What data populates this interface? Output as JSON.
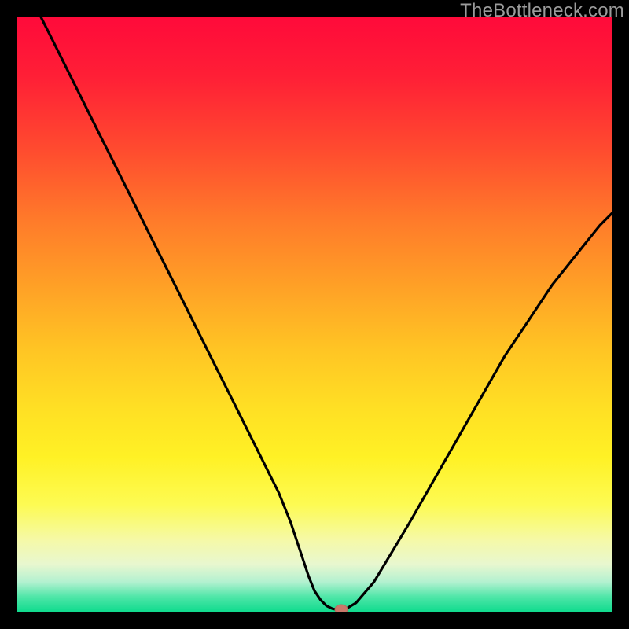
{
  "watermark": "TheBottleneck.com",
  "colors": {
    "frame": "#000000",
    "curve": "#000000",
    "marker_fill": "#c9786a",
    "marker_stroke": "#b86c5f",
    "gradient_top": "#ff0a3a",
    "gradient_bottom": "#10db8e"
  },
  "chart_data": {
    "type": "line",
    "title": "",
    "xlabel": "",
    "ylabel": "",
    "xlim": [
      0,
      100
    ],
    "ylim": [
      0,
      100
    ],
    "series": [
      {
        "name": "bottleneck-curve",
        "x": [
          4,
          6,
          8,
          10,
          12,
          14,
          16,
          18,
          20,
          22,
          24,
          26,
          28,
          30,
          32,
          34,
          36,
          38,
          40,
          42,
          44,
          46,
          47,
          48,
          49,
          50,
          51,
          52,
          53,
          54,
          55,
          57,
          60,
          63,
          66,
          70,
          74,
          78,
          82,
          86,
          90,
          94,
          98,
          100
        ],
        "y": [
          100,
          96,
          92,
          88,
          84,
          80,
          76,
          72,
          68,
          64,
          60,
          56,
          52,
          48,
          44,
          40,
          36,
          32,
          28,
          24,
          20,
          15,
          12,
          9,
          6,
          3.5,
          2,
          1,
          0.5,
          0.3,
          0.3,
          1.5,
          5,
          10,
          15,
          22,
          29,
          36,
          43,
          49,
          55,
          60,
          65,
          67
        ]
      }
    ],
    "annotations": [
      {
        "name": "optimal-marker",
        "x": 54.5,
        "y": 0.4
      }
    ]
  }
}
